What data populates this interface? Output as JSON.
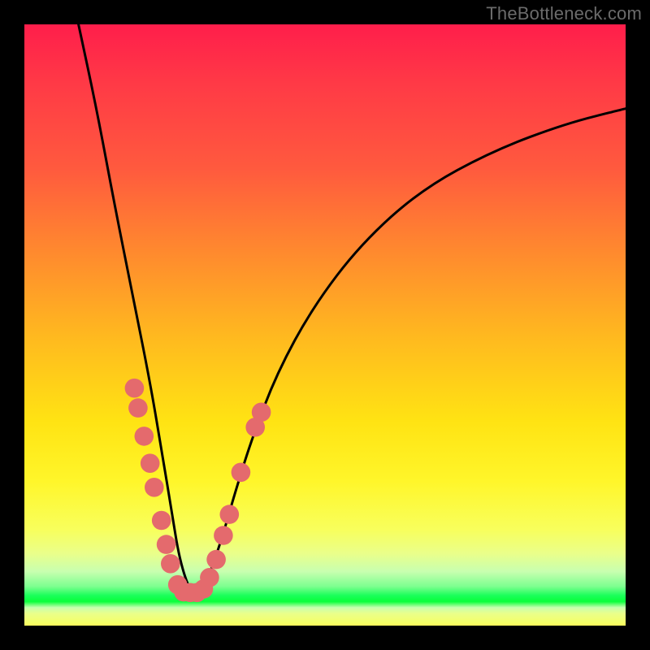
{
  "watermark": "TheBottleneck.com",
  "colors": {
    "dot": "#e46a6d",
    "curve_stroke": "#000000",
    "frame": "#000000"
  },
  "chart_data": {
    "type": "line",
    "title": "",
    "xlabel": "",
    "ylabel": "",
    "xlim": [
      0,
      100
    ],
    "ylim": [
      0,
      100
    ],
    "grid": false,
    "legend": false,
    "series": [
      {
        "name": "bottleneck-curve",
        "x": [
          9,
          12,
          15,
          18,
          21,
          23,
          24.5,
          25.8,
          27.6,
          29.2,
          31,
          33,
          35,
          37.8,
          42,
          48,
          56,
          66,
          78,
          90,
          100
        ],
        "y": [
          100,
          86,
          70,
          55,
          40,
          28,
          19,
          11,
          5.5,
          5.5,
          9,
          15,
          22,
          31,
          42,
          53,
          63.5,
          72.5,
          79,
          83.5,
          86
        ]
      }
    ],
    "markers": [
      {
        "x": 18.3,
        "y": 39.5,
        "r": 1.6
      },
      {
        "x": 18.9,
        "y": 36.2,
        "r": 1.6
      },
      {
        "x": 19.9,
        "y": 31.5,
        "r": 1.6
      },
      {
        "x": 20.9,
        "y": 27.0,
        "r": 1.6
      },
      {
        "x": 21.6,
        "y": 23.0,
        "r": 1.6
      },
      {
        "x": 22.8,
        "y": 17.5,
        "r": 1.6
      },
      {
        "x": 23.6,
        "y": 13.5,
        "r": 1.6
      },
      {
        "x": 24.3,
        "y": 10.3,
        "r": 1.6
      },
      {
        "x": 25.5,
        "y": 6.8,
        "r": 1.6
      },
      {
        "x": 26.5,
        "y": 5.6,
        "r": 1.6
      },
      {
        "x": 27.6,
        "y": 5.5,
        "r": 1.6
      },
      {
        "x": 28.7,
        "y": 5.5,
        "r": 1.6
      },
      {
        "x": 29.8,
        "y": 6.1,
        "r": 1.6
      },
      {
        "x": 30.8,
        "y": 8.0,
        "r": 1.6
      },
      {
        "x": 31.9,
        "y": 11.0,
        "r": 1.6
      },
      {
        "x": 33.1,
        "y": 15.0,
        "r": 1.6
      },
      {
        "x": 34.1,
        "y": 18.5,
        "r": 1.6
      },
      {
        "x": 36.0,
        "y": 25.5,
        "r": 1.6
      },
      {
        "x": 38.4,
        "y": 33.0,
        "r": 1.6
      },
      {
        "x": 39.4,
        "y": 35.5,
        "r": 1.6
      }
    ]
  }
}
